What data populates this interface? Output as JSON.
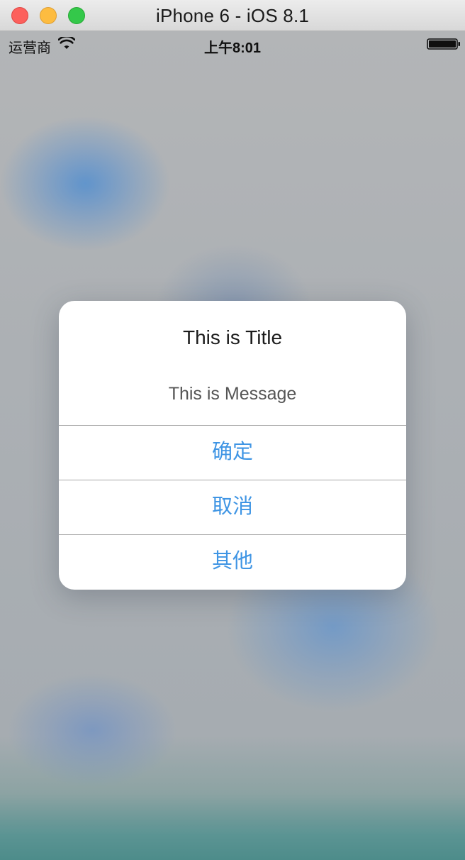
{
  "window": {
    "title": "iPhone 6 - iOS 8.1"
  },
  "statusbar": {
    "carrier": "运营商",
    "time": "上午8:01",
    "wifi_icon": "wifi-icon",
    "battery_icon": "battery-icon"
  },
  "alert": {
    "title": "This is Title",
    "message": "This is Message",
    "buttons": [
      {
        "label": "确定"
      },
      {
        "label": "取消"
      },
      {
        "label": "其他"
      }
    ],
    "button_color": "#3f95e4"
  }
}
